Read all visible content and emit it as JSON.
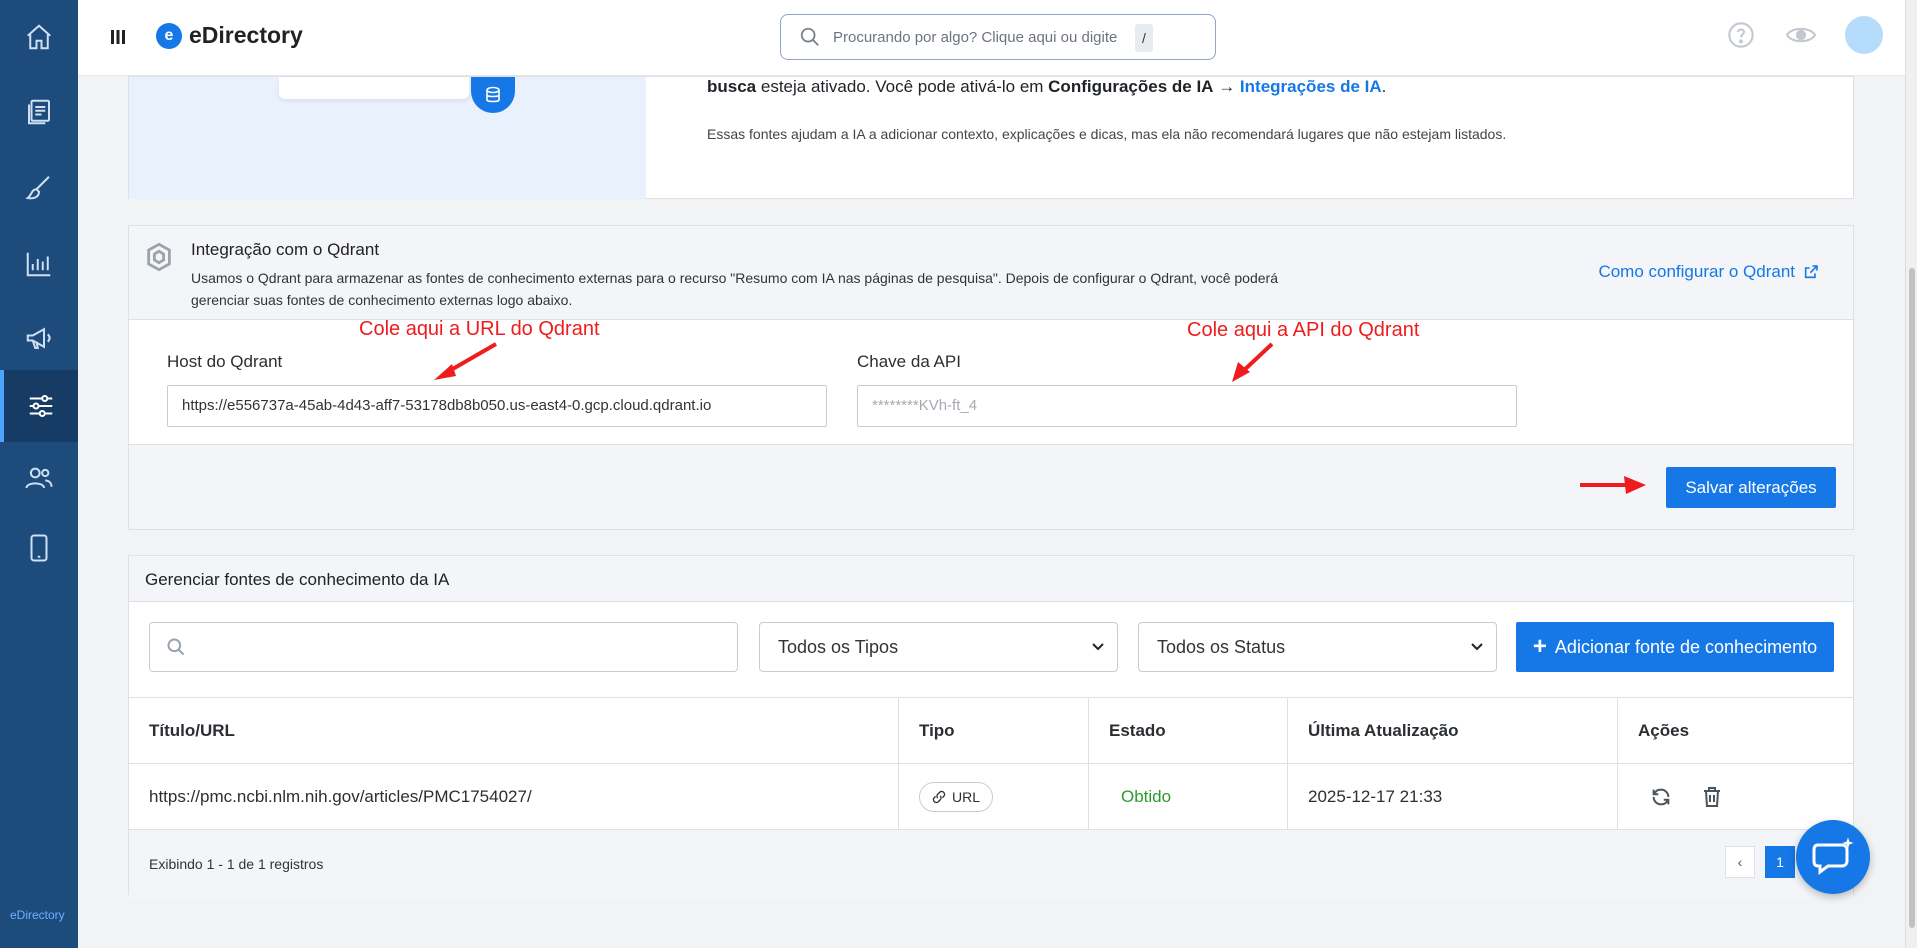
{
  "app": {
    "brand": "eDirectory",
    "brand_badge": "e",
    "sidebar_brand": "eDirectory"
  },
  "colors": {
    "sidebar": "#1d4b7c",
    "accent": "#1678e6",
    "annotation": "#ee1c1c",
    "success": "#2c9a2c"
  },
  "sidebar": {
    "items": [
      {
        "name": "home-icon",
        "active": false
      },
      {
        "name": "content-icon",
        "active": false
      },
      {
        "name": "design-icon",
        "active": false
      },
      {
        "name": "reports-icon",
        "active": false
      },
      {
        "name": "promotion-icon",
        "active": false
      },
      {
        "name": "settings-icon",
        "active": true
      },
      {
        "name": "users-icon",
        "active": false
      },
      {
        "name": "mobile-icon",
        "active": false
      }
    ]
  },
  "topbar": {
    "search_placeholder": "Procurando por algo? Clique aqui ou digite",
    "search_shortcut": "/"
  },
  "info_card": {
    "line1_bold_prefix": "busca",
    "line1_text": " esteja ativado. Você pode ativá-lo em ",
    "line1_bold_link": "Configurações de IA",
    "line1_arrow": " → ",
    "line1_link": "Integrações de IA",
    "line1_end": ".",
    "line2": "Essas fontes ajudam a IA a adicionar contexto, explicações e dicas, mas ela não recomendará lugares que não estejam listados."
  },
  "qdrant": {
    "title": "Integração com o Qdrant",
    "description": "Usamos o Qdrant para armazenar as fontes de conhecimento externas para o recurso \"Resumo com IA nas páginas de pesquisa\". Depois de configurar o Qdrant, você poderá gerenciar suas fontes de conhecimento externas logo abaixo.",
    "help_link": "Como configurar o Qdrant",
    "host_label": "Host do Qdrant",
    "host_value": "https://e556737a-45ab-4d43-aff7-53178db8b050.us-east4-0.gcp.cloud.qdrant.io",
    "api_label": "Chave da API",
    "api_value": "********KVh-ft_4",
    "annotation_host": "Cole aqui a URL do Qdrant",
    "annotation_api": "Cole aqui a API do Qdrant",
    "save_label": "Salvar alterações"
  },
  "knowledge": {
    "title": "Gerenciar fontes de conhecimento da IA",
    "search_value": "",
    "type_filter": "Todos os Tipos",
    "status_filter": "Todos os Status",
    "add_label": "Adicionar fonte de conhecimento",
    "columns": [
      "Título/URL",
      "Tipo",
      "Estado",
      "Última Atualização",
      "Ações"
    ],
    "rows": [
      {
        "title": "https://pmc.ncbi.nlm.nih.gov/articles/PMC1754027/",
        "type": "URL",
        "status": "Obtido",
        "updated": "2025-12-17 21:33"
      }
    ],
    "footer": "Exibindo 1 - 1 de 1 registros",
    "page_current": "1",
    "page_prev": "‹"
  }
}
